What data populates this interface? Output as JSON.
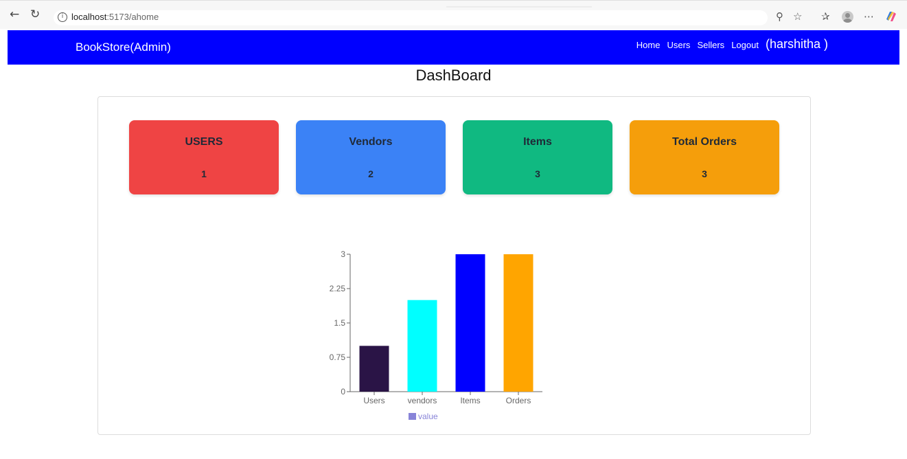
{
  "browser": {
    "url_host": "localhost",
    "url_path": ":5173/ahome"
  },
  "navbar": {
    "brand": "BookStore(Admin)",
    "links": [
      "Home",
      "Users",
      "Sellers",
      "Logout"
    ],
    "user": "(harshitha )"
  },
  "page_title": "DashBoard",
  "stats": [
    {
      "title": "USERS",
      "value": "1",
      "color": "#ef4444"
    },
    {
      "title": "Vendors",
      "value": "2",
      "color": "#3b82f6"
    },
    {
      "title": "Items",
      "value": "3",
      "color": "#10b981"
    },
    {
      "title": "Total Orders",
      "value": "3",
      "color": "#f59e0b"
    }
  ],
  "chart_data": {
    "type": "bar",
    "categories": [
      "Users",
      "vendors",
      "Items",
      "Orders"
    ],
    "values": [
      1,
      2,
      3,
      3
    ],
    "colors": [
      "#2a1446",
      "#00ffff",
      "#0000ff",
      "#ffa500"
    ],
    "yticks": [
      "0",
      "0.75",
      "1.5",
      "2.25",
      "3"
    ],
    "ylim": [
      0,
      3
    ],
    "legend": "value",
    "legend_color": "#8884d8",
    "grid": false
  }
}
